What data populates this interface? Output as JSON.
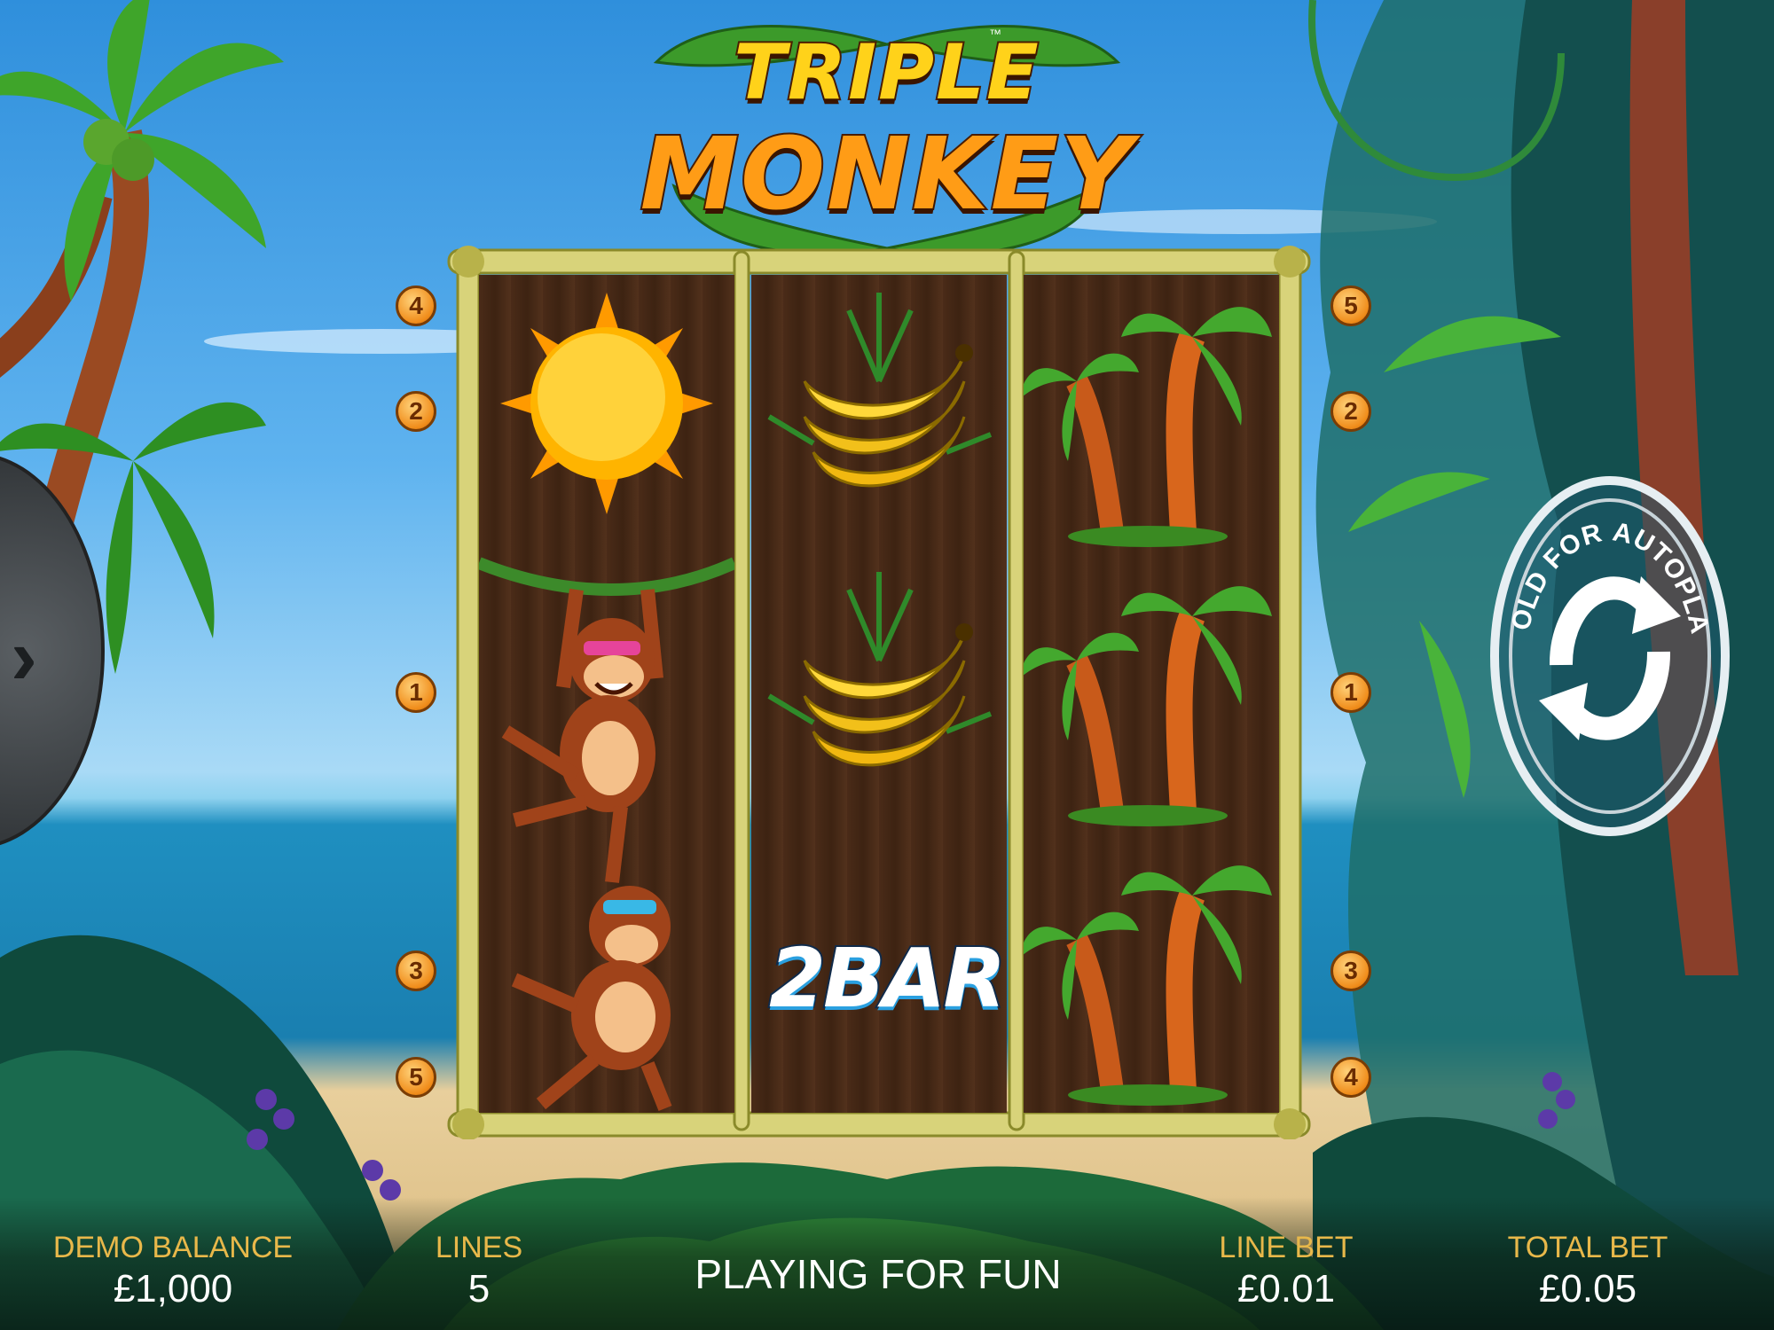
{
  "game": {
    "title_line1": "TRIPLE",
    "title_line2": "MONKEY",
    "trademark": "™"
  },
  "reels": [
    [
      "sun",
      "monkey-hanging",
      "monkey-hanging-lower"
    ],
    [
      "bananas",
      "bananas",
      "2bar"
    ],
    [
      "palm-trees",
      "palm-trees",
      "palm-trees"
    ]
  ],
  "symbols": {
    "bar_text": "2BAR"
  },
  "paylines": {
    "left": [
      "4",
      "2",
      "1",
      "3",
      "5"
    ],
    "right": [
      "5",
      "2",
      "1",
      "3",
      "4"
    ]
  },
  "autoplay": {
    "label": "HOLD FOR AUTOPLAY"
  },
  "side_menu": {
    "icon": "chevron-right-icon"
  },
  "status": {
    "balance_label": "DEMO BALANCE",
    "balance_value": "£1,000",
    "lines_label": "LINES",
    "lines_value": "5",
    "message": "PLAYING FOR FUN",
    "line_bet_label": "LINE BET",
    "line_bet_value": "£0.01",
    "total_bet_label": "TOTAL BET",
    "total_bet_value": "£0.05"
  },
  "colors": {
    "label_gold": "#e8b84a",
    "value_white": "#ffffff",
    "reel_wood": "#4a2b18",
    "frame_bamboo": "#d8d37a"
  }
}
